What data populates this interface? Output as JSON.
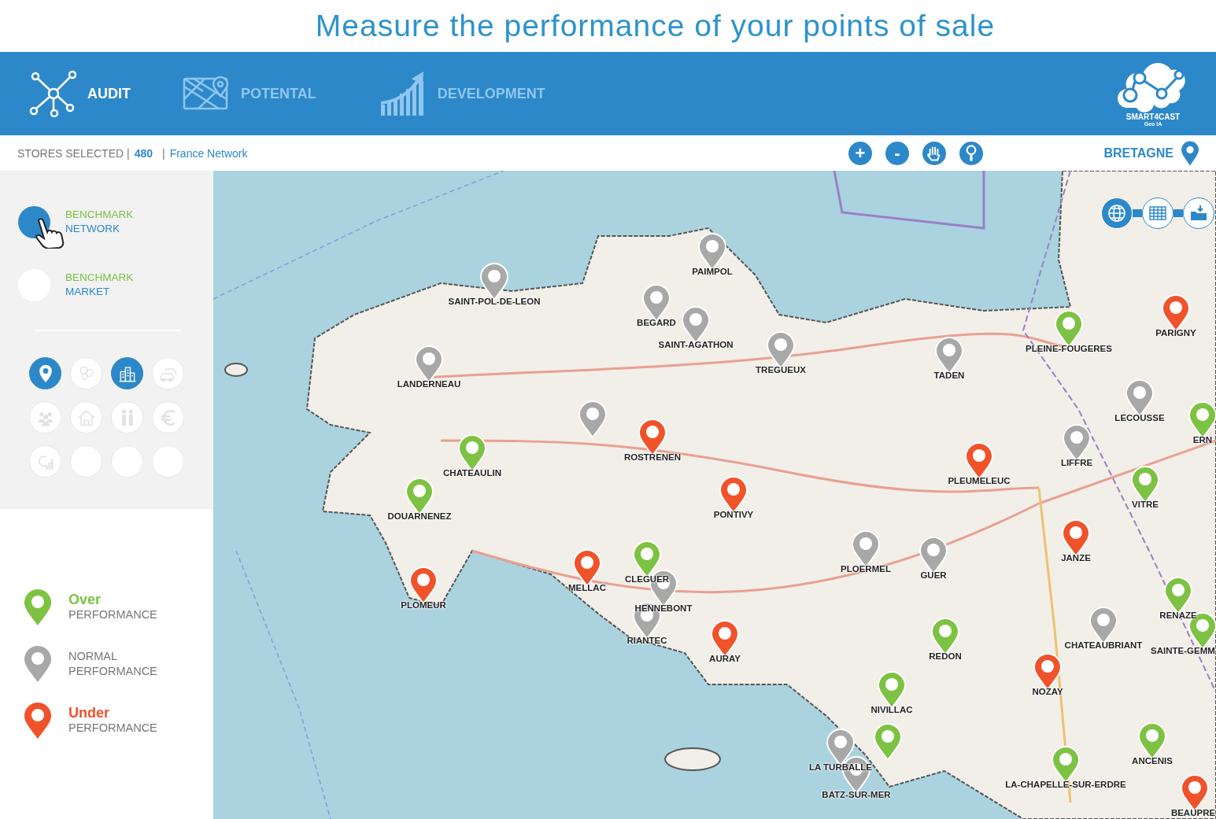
{
  "page_title": "Measure the performance of your points of sale",
  "nav": [
    {
      "label": "AUDIT",
      "selected": true
    },
    {
      "label": "POTENTAL",
      "selected": false
    },
    {
      "label": "DEVELOPMENT",
      "selected": false
    }
  ],
  "logo": {
    "name": "SMART4CAST",
    "tagline": "Geo IA"
  },
  "toolbar": {
    "stores_label": "STORES SELECTED |",
    "stores_count": "480",
    "separator": "|",
    "network": "France Network",
    "region": "BRETAGNE"
  },
  "map_buttons": [
    {
      "symbol": "+"
    },
    {
      "symbol": "-"
    }
  ],
  "benchmarks": [
    {
      "line1": "BENCHMARK",
      "line2": "NETWORK",
      "selected": true
    },
    {
      "line1": "BENCHMARK",
      "line2": "MARKET",
      "selected": false
    }
  ],
  "filters": [
    {
      "selected": true
    },
    {
      "selected": false
    },
    {
      "selected": true
    },
    {
      "selected": false
    },
    {
      "selected": false
    },
    {
      "selected": false
    },
    {
      "selected": false
    },
    {
      "selected": false
    },
    {
      "selected": false
    },
    {
      "selected": false
    },
    {
      "selected": false
    },
    {
      "selected": false
    }
  ],
  "legend": [
    {
      "kind": "emphasis",
      "color": "#7dc242",
      "title": "Over",
      "subtitle": "PERFORMANCE"
    },
    {
      "kind": "plain",
      "color": "#a8a8a8",
      "title": "NORMAL",
      "subtitle": "PERFORMANCE"
    },
    {
      "kind": "emphasis",
      "color": "#f0522a",
      "title": "Under",
      "subtitle": "PERFORMANCE"
    }
  ],
  "view_buttons": [
    {
      "selected": true
    },
    {
      "selected": false
    },
    {
      "selected": false
    }
  ],
  "pins": [
    {
      "label": "PAIMPOL",
      "color": "#a8a8a8"
    },
    {
      "label": "SAINT-POL-DE-LEON",
      "color": "#a8a8a8"
    },
    {
      "label": "BEGARD",
      "color": "#a8a8a8"
    },
    {
      "label": "SAINT-AGATHON",
      "color": "#a8a8a8"
    },
    {
      "label": "TREGUEUX",
      "color": "#a8a8a8"
    },
    {
      "label": "TADEN",
      "color": "#a8a8a8"
    },
    {
      "label": "PLEINE-FOUGERES",
      "color": "#7dc242"
    },
    {
      "label": "PARIGNY",
      "color": "#f0522a"
    },
    {
      "label": "LANDERNEAU",
      "color": "#a8a8a8"
    },
    {
      "label": "LECOUSSE",
      "color": "#a8a8a8"
    },
    {
      "label": "ERN",
      "color": "#7dc242"
    },
    {
      "color": "#a8a8a8"
    },
    {
      "label": "ROSTRENEN",
      "color": "#f0522a"
    },
    {
      "label": "CHATEAULIN",
      "color": "#7dc242"
    },
    {
      "label": "LIFFRE",
      "color": "#a8a8a8"
    },
    {
      "label": "PLEUMELEUC",
      "color": "#f0522a"
    },
    {
      "label": "VITRE",
      "color": "#7dc242"
    },
    {
      "label": "DOUARNENEZ",
      "color": "#7dc242"
    },
    {
      "label": "PONTIVY",
      "color": "#f0522a"
    },
    {
      "label": "JANZE",
      "color": "#f0522a"
    },
    {
      "label": "PLOERMEL",
      "color": "#a8a8a8"
    },
    {
      "label": "GUER",
      "color": "#a8a8a8"
    },
    {
      "label": "CLEGUER",
      "color": "#7dc242"
    },
    {
      "label": "HENNEBONT",
      "color": "#a8a8a8"
    },
    {
      "label": "MELLAC",
      "color": "#f0522a"
    },
    {
      "label": "PLOMEUR",
      "color": "#f0522a"
    },
    {
      "label": "RENAZE",
      "color": "#7dc242"
    },
    {
      "label": "RIANTEC",
      "color": "#a8a8a8"
    },
    {
      "label": "AURAY",
      "color": "#f0522a"
    },
    {
      "label": "REDON",
      "color": "#7dc242"
    },
    {
      "label": "CHATEAUBRIANT",
      "color": "#a8a8a8"
    },
    {
      "label": "SAINTE-GEMM",
      "color": "#7dc242"
    },
    {
      "label": "NOZAY",
      "color": "#f0522a"
    },
    {
      "label": "NIVILLAC",
      "color": "#7dc242"
    },
    {
      "color": "#7dc242"
    },
    {
      "label": "LA TURBALLE",
      "color": "#a8a8a8"
    },
    {
      "label": "BATZ-SUR-MER",
      "color": "#a8a8a8"
    },
    {
      "label": "ANCENIS",
      "color": "#7dc242"
    },
    {
      "label": "LA-CHAPELLE-SUR-ERDRE",
      "color": "#7dc242"
    },
    {
      "label": "BEAUPRE",
      "color": "#f0522a"
    }
  ]
}
